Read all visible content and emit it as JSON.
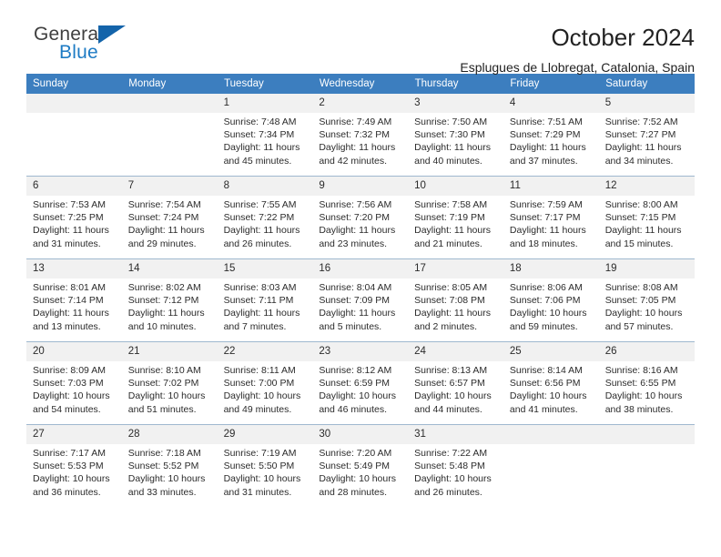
{
  "brand": {
    "name_top": "General",
    "name_bottom": "Blue",
    "logo_icon": "triangle-icon",
    "colors": {
      "general": "#3f3f3f",
      "blue": "#1e7bc4",
      "triangle": "#1464aa"
    }
  },
  "header": {
    "title": "October 2024",
    "subtitle": "Esplugues de Llobregat, Catalonia, Spain"
  },
  "theme": {
    "header_bg": "#3c7ebf",
    "header_text": "#ffffff",
    "daynum_bg": "#f1f1f1",
    "row_divider": "#9fb8cf"
  },
  "calendar": {
    "weekday_headers": [
      "Sunday",
      "Monday",
      "Tuesday",
      "Wednesday",
      "Thursday",
      "Friday",
      "Saturday"
    ],
    "weeks": [
      [
        {
          "day": "",
          "sunrise": "",
          "sunset": "",
          "daylight_line1": "",
          "daylight_line2": ""
        },
        {
          "day": "",
          "sunrise": "",
          "sunset": "",
          "daylight_line1": "",
          "daylight_line2": ""
        },
        {
          "day": "1",
          "sunrise": "Sunrise: 7:48 AM",
          "sunset": "Sunset: 7:34 PM",
          "daylight_line1": "Daylight: 11 hours",
          "daylight_line2": "and 45 minutes."
        },
        {
          "day": "2",
          "sunrise": "Sunrise: 7:49 AM",
          "sunset": "Sunset: 7:32 PM",
          "daylight_line1": "Daylight: 11 hours",
          "daylight_line2": "and 42 minutes."
        },
        {
          "day": "3",
          "sunrise": "Sunrise: 7:50 AM",
          "sunset": "Sunset: 7:30 PM",
          "daylight_line1": "Daylight: 11 hours",
          "daylight_line2": "and 40 minutes."
        },
        {
          "day": "4",
          "sunrise": "Sunrise: 7:51 AM",
          "sunset": "Sunset: 7:29 PM",
          "daylight_line1": "Daylight: 11 hours",
          "daylight_line2": "and 37 minutes."
        },
        {
          "day": "5",
          "sunrise": "Sunrise: 7:52 AM",
          "sunset": "Sunset: 7:27 PM",
          "daylight_line1": "Daylight: 11 hours",
          "daylight_line2": "and 34 minutes."
        }
      ],
      [
        {
          "day": "6",
          "sunrise": "Sunrise: 7:53 AM",
          "sunset": "Sunset: 7:25 PM",
          "daylight_line1": "Daylight: 11 hours",
          "daylight_line2": "and 31 minutes."
        },
        {
          "day": "7",
          "sunrise": "Sunrise: 7:54 AM",
          "sunset": "Sunset: 7:24 PM",
          "daylight_line1": "Daylight: 11 hours",
          "daylight_line2": "and 29 minutes."
        },
        {
          "day": "8",
          "sunrise": "Sunrise: 7:55 AM",
          "sunset": "Sunset: 7:22 PM",
          "daylight_line1": "Daylight: 11 hours",
          "daylight_line2": "and 26 minutes."
        },
        {
          "day": "9",
          "sunrise": "Sunrise: 7:56 AM",
          "sunset": "Sunset: 7:20 PM",
          "daylight_line1": "Daylight: 11 hours",
          "daylight_line2": "and 23 minutes."
        },
        {
          "day": "10",
          "sunrise": "Sunrise: 7:58 AM",
          "sunset": "Sunset: 7:19 PM",
          "daylight_line1": "Daylight: 11 hours",
          "daylight_line2": "and 21 minutes."
        },
        {
          "day": "11",
          "sunrise": "Sunrise: 7:59 AM",
          "sunset": "Sunset: 7:17 PM",
          "daylight_line1": "Daylight: 11 hours",
          "daylight_line2": "and 18 minutes."
        },
        {
          "day": "12",
          "sunrise": "Sunrise: 8:00 AM",
          "sunset": "Sunset: 7:15 PM",
          "daylight_line1": "Daylight: 11 hours",
          "daylight_line2": "and 15 minutes."
        }
      ],
      [
        {
          "day": "13",
          "sunrise": "Sunrise: 8:01 AM",
          "sunset": "Sunset: 7:14 PM",
          "daylight_line1": "Daylight: 11 hours",
          "daylight_line2": "and 13 minutes."
        },
        {
          "day": "14",
          "sunrise": "Sunrise: 8:02 AM",
          "sunset": "Sunset: 7:12 PM",
          "daylight_line1": "Daylight: 11 hours",
          "daylight_line2": "and 10 minutes."
        },
        {
          "day": "15",
          "sunrise": "Sunrise: 8:03 AM",
          "sunset": "Sunset: 7:11 PM",
          "daylight_line1": "Daylight: 11 hours",
          "daylight_line2": "and 7 minutes."
        },
        {
          "day": "16",
          "sunrise": "Sunrise: 8:04 AM",
          "sunset": "Sunset: 7:09 PM",
          "daylight_line1": "Daylight: 11 hours",
          "daylight_line2": "and 5 minutes."
        },
        {
          "day": "17",
          "sunrise": "Sunrise: 8:05 AM",
          "sunset": "Sunset: 7:08 PM",
          "daylight_line1": "Daylight: 11 hours",
          "daylight_line2": "and 2 minutes."
        },
        {
          "day": "18",
          "sunrise": "Sunrise: 8:06 AM",
          "sunset": "Sunset: 7:06 PM",
          "daylight_line1": "Daylight: 10 hours",
          "daylight_line2": "and 59 minutes."
        },
        {
          "day": "19",
          "sunrise": "Sunrise: 8:08 AM",
          "sunset": "Sunset: 7:05 PM",
          "daylight_line1": "Daylight: 10 hours",
          "daylight_line2": "and 57 minutes."
        }
      ],
      [
        {
          "day": "20",
          "sunrise": "Sunrise: 8:09 AM",
          "sunset": "Sunset: 7:03 PM",
          "daylight_line1": "Daylight: 10 hours",
          "daylight_line2": "and 54 minutes."
        },
        {
          "day": "21",
          "sunrise": "Sunrise: 8:10 AM",
          "sunset": "Sunset: 7:02 PM",
          "daylight_line1": "Daylight: 10 hours",
          "daylight_line2": "and 51 minutes."
        },
        {
          "day": "22",
          "sunrise": "Sunrise: 8:11 AM",
          "sunset": "Sunset: 7:00 PM",
          "daylight_line1": "Daylight: 10 hours",
          "daylight_line2": "and 49 minutes."
        },
        {
          "day": "23",
          "sunrise": "Sunrise: 8:12 AM",
          "sunset": "Sunset: 6:59 PM",
          "daylight_line1": "Daylight: 10 hours",
          "daylight_line2": "and 46 minutes."
        },
        {
          "day": "24",
          "sunrise": "Sunrise: 8:13 AM",
          "sunset": "Sunset: 6:57 PM",
          "daylight_line1": "Daylight: 10 hours",
          "daylight_line2": "and 44 minutes."
        },
        {
          "day": "25",
          "sunrise": "Sunrise: 8:14 AM",
          "sunset": "Sunset: 6:56 PM",
          "daylight_line1": "Daylight: 10 hours",
          "daylight_line2": "and 41 minutes."
        },
        {
          "day": "26",
          "sunrise": "Sunrise: 8:16 AM",
          "sunset": "Sunset: 6:55 PM",
          "daylight_line1": "Daylight: 10 hours",
          "daylight_line2": "and 38 minutes."
        }
      ],
      [
        {
          "day": "27",
          "sunrise": "Sunrise: 7:17 AM",
          "sunset": "Sunset: 5:53 PM",
          "daylight_line1": "Daylight: 10 hours",
          "daylight_line2": "and 36 minutes."
        },
        {
          "day": "28",
          "sunrise": "Sunrise: 7:18 AM",
          "sunset": "Sunset: 5:52 PM",
          "daylight_line1": "Daylight: 10 hours",
          "daylight_line2": "and 33 minutes."
        },
        {
          "day": "29",
          "sunrise": "Sunrise: 7:19 AM",
          "sunset": "Sunset: 5:50 PM",
          "daylight_line1": "Daylight: 10 hours",
          "daylight_line2": "and 31 minutes."
        },
        {
          "day": "30",
          "sunrise": "Sunrise: 7:20 AM",
          "sunset": "Sunset: 5:49 PM",
          "daylight_line1": "Daylight: 10 hours",
          "daylight_line2": "and 28 minutes."
        },
        {
          "day": "31",
          "sunrise": "Sunrise: 7:22 AM",
          "sunset": "Sunset: 5:48 PM",
          "daylight_line1": "Daylight: 10 hours",
          "daylight_line2": "and 26 minutes."
        },
        {
          "day": "",
          "sunrise": "",
          "sunset": "",
          "daylight_line1": "",
          "daylight_line2": ""
        },
        {
          "day": "",
          "sunrise": "",
          "sunset": "",
          "daylight_line1": "",
          "daylight_line2": ""
        }
      ]
    ]
  }
}
